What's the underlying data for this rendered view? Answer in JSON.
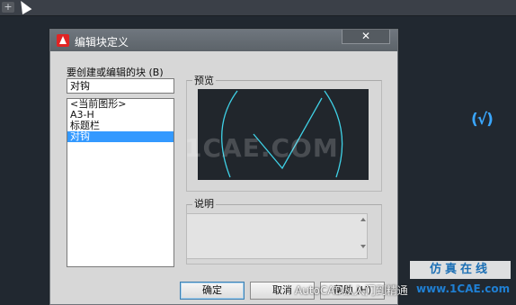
{
  "app": {
    "new_tab_symbol": "+"
  },
  "canvas": {
    "check_glyph": "(√)",
    "check_color": "#3aa7ff"
  },
  "dialog": {
    "title": "编辑块定义",
    "close_symbol": "✕",
    "block_name_label": "要创建或编辑的块 (B)",
    "block_name_value": "对钩",
    "block_list": [
      {
        "label": "<当前图形>",
        "selected": false
      },
      {
        "label": "A3-H",
        "selected": false
      },
      {
        "label": "标题栏",
        "selected": false
      },
      {
        "label": "对钩",
        "selected": true
      }
    ],
    "preview_label": "预览",
    "description_label": "说明",
    "description_value": "",
    "buttons": {
      "ok": "确定",
      "cancel": "取消",
      "help": "帮助 (H)"
    }
  },
  "watermarks": {
    "center": "1CAE.COM",
    "bottom_text": "AutoCAD从入门到精通",
    "logo_text": "仿真在线",
    "site": "www.1CAE.com"
  },
  "colors": {
    "selection": "#3399ff",
    "preview_bg": "#21262c",
    "preview_stroke": "#3fd1e6",
    "canvas_bg": "#212830"
  }
}
